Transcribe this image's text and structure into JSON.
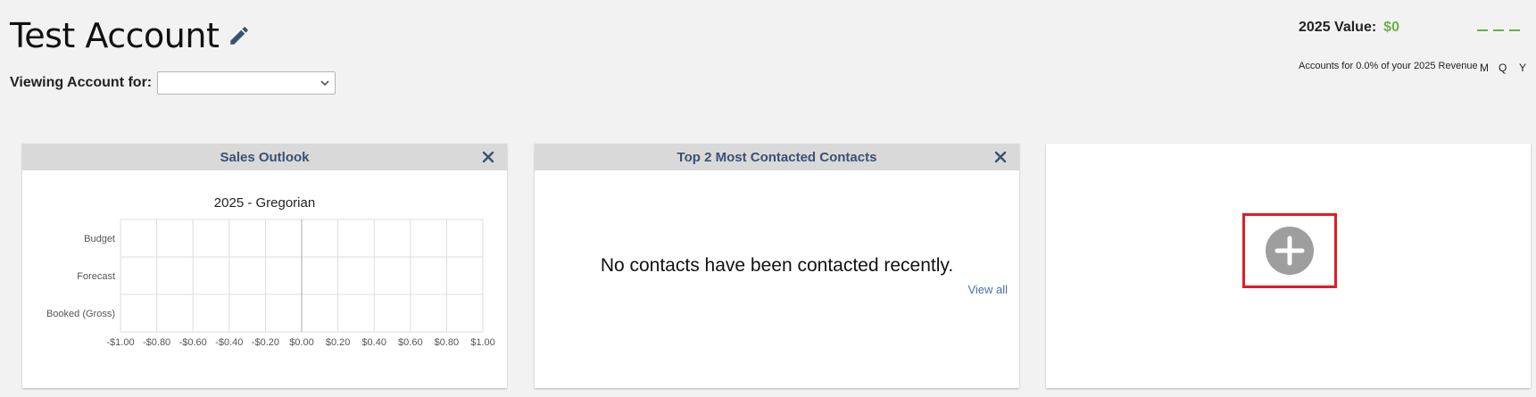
{
  "header": {
    "account_title": "Test Account",
    "viewing_label": "Viewing Account for:",
    "viewing_select_value": ""
  },
  "value_panel": {
    "label": "2025 Value:",
    "amount": "$0",
    "accounts_text": "Accounts for 0.0% of your 2025 Revenue",
    "periods": [
      "M",
      "Q",
      "Y"
    ],
    "accent_color": "#6ab04c"
  },
  "cards": {
    "sales_outlook": {
      "title": "Sales Outlook",
      "close_icon": "close-icon"
    },
    "top_contacts": {
      "title": "Top 2 Most Contacted Contacts",
      "empty_message": "No contacts have been contacted recently.",
      "view_all": "View all",
      "close_icon": "close-icon"
    },
    "add_widget": {
      "icon": "plus-circle-icon",
      "highlight_color": "#e31b23"
    }
  },
  "chart_data": {
    "type": "bar",
    "orientation": "horizontal",
    "title": "2025 - Gregorian",
    "categories": [
      "Budget",
      "Forecast",
      "Booked (Gross)"
    ],
    "values": [
      0,
      0,
      0
    ],
    "xlim": [
      -1.0,
      1.0
    ],
    "x_ticks": [
      "-$1.00",
      "-$0.80",
      "-$0.60",
      "-$0.40",
      "-$0.20",
      "$0.00",
      "$0.20",
      "$0.40",
      "$0.60",
      "$0.80",
      "$1.00"
    ],
    "grid": true
  }
}
